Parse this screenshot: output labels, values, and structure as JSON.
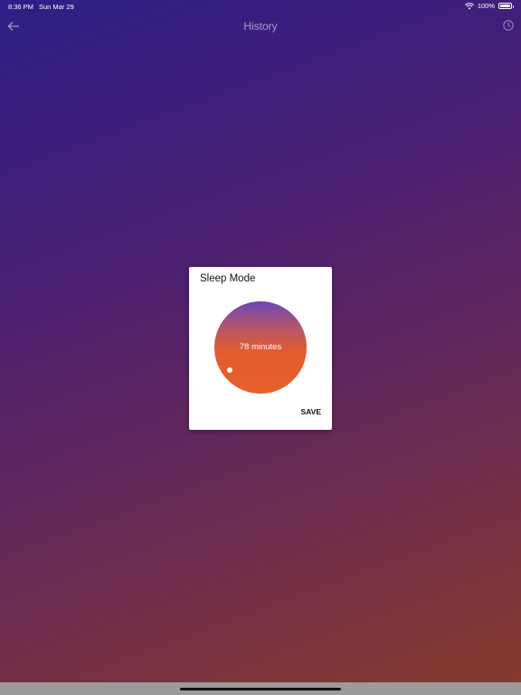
{
  "status_bar": {
    "time": "8:36 PM",
    "date": "Sun Mar 29",
    "battery": "100%",
    "battery_level": 1.0
  },
  "header": {
    "back_icon": "arrow-left-icon",
    "title": "History",
    "right_icon": "timer-icon"
  },
  "dialog": {
    "title": "Sleep Mode",
    "dial_value": "78 minutes",
    "save_label": "SAVE"
  },
  "colors": {
    "background_start": "#2d1f86",
    "background_end": "#873a2a",
    "dial_top": "#6a45b9",
    "dial_bottom": "#e8602a"
  }
}
